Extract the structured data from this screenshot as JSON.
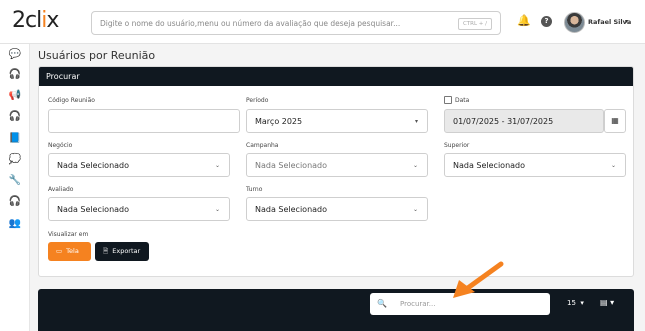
{
  "header": {
    "logo_main": "2cl",
    "logo_accent": "i",
    "logo_tail": "x",
    "search_placeholder": "Digite o nome do usuário,menu ou número da avaliação que deseja pesquisar...",
    "search_shortcut": "CTRL + /",
    "user_name": "Rafael Silva",
    "user_caret": "▾"
  },
  "sidebar": {
    "items": [
      {
        "icon": "chat-bubbles-icon",
        "glyph": "💬"
      },
      {
        "icon": "headset-icon",
        "glyph": "🎧"
      },
      {
        "icon": "megaphone-icon",
        "glyph": "📢"
      },
      {
        "icon": "headphones-icon",
        "glyph": "🎧"
      },
      {
        "icon": "book-icon",
        "glyph": "📘"
      },
      {
        "icon": "chat-question-icon",
        "glyph": "💭"
      },
      {
        "icon": "wrench-icon",
        "glyph": "🔧"
      },
      {
        "icon": "headset-alt-icon",
        "glyph": "🎧"
      },
      {
        "icon": "users-icon",
        "glyph": "👥"
      }
    ]
  },
  "page": {
    "title": "Usuários por Reunião"
  },
  "filters": {
    "panel_title": "Procurar",
    "codigo_label": "Código Reunião",
    "codigo_value": "",
    "periodo_label": "Período",
    "periodo_value": "Março 2025",
    "data_label": "Data",
    "data_value": "01/07/2025 - 31/07/2025",
    "negocio_label": "Negócio",
    "negocio_value": "Nada Selecionado",
    "campanha_label": "Campanha",
    "campanha_value": "Nada Selecionado",
    "superior_label": "Superior",
    "superior_value": "Nada Selecionado",
    "avaliado_label": "Avaliado",
    "avaliado_value": "Nada Selecionado",
    "turno_label": "Turno",
    "turno_value": "Nada Selecionado",
    "visualizar_label": "Visualizar em",
    "tela_label": "Tela",
    "exportar_label": "Exportar"
  },
  "results": {
    "search_placeholder": "Procurar...",
    "page_size": "15",
    "caret": "▾"
  },
  "colors": {
    "accent": "#f58220",
    "dark": "#101820"
  }
}
